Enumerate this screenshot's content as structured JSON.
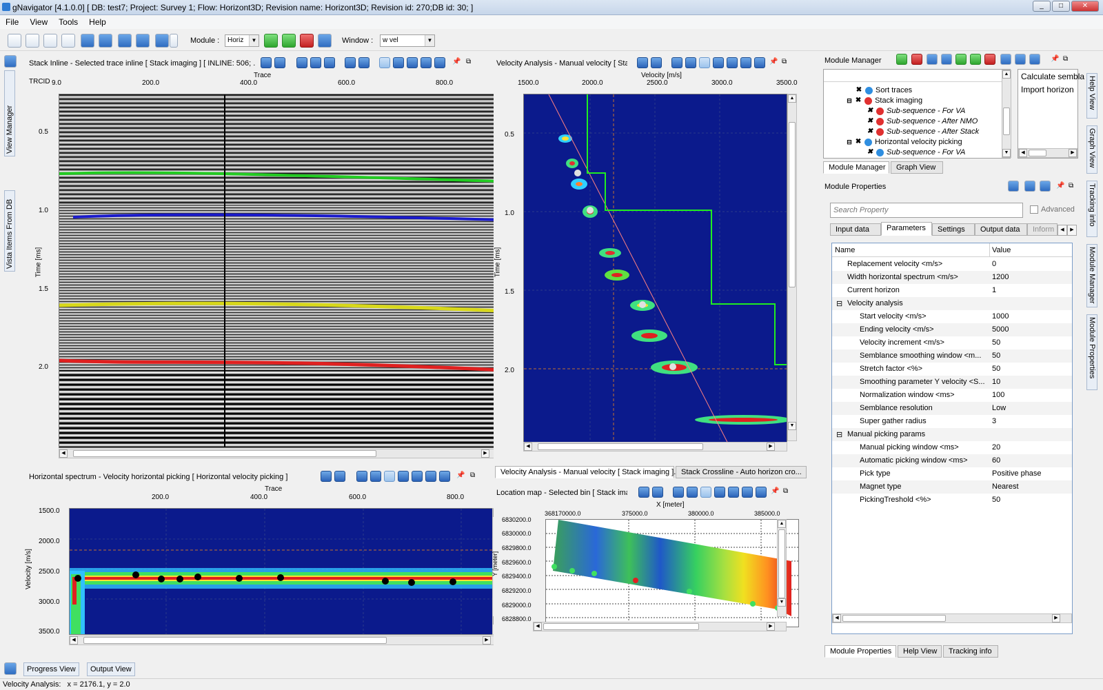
{
  "window": {
    "title": "gNavigator [4.1.0.0] [ DB: test7; Project: Survey 1; Flow: Horizont3D; Revision name: Horizont3D; Revision id: 270;DB id: 30; ]",
    "minimize": "_",
    "maximize": "□",
    "close": "✕"
  },
  "menu": {
    "file": "File",
    "view": "View",
    "tools": "Tools",
    "help": "Help"
  },
  "toolbar": {
    "module_label": "Module :",
    "module_value": "Horiz",
    "window_label": "Window :",
    "window_value": "w vel"
  },
  "left_sidebar": {
    "view_manager": "View Manager",
    "vista_items": "Vista Items From DB"
  },
  "right_sidebar": {
    "help_view": "Help View",
    "graph_view": "Graph View",
    "tracking_info": "Tracking info",
    "module_manager": "Module Manager",
    "module_properties": "Module Properties"
  },
  "stack_panel": {
    "title": "Stack Inline - Selected trace inline [ Stack imaging ] [ INLINE: 506; ...",
    "top_axis_label": "Trace",
    "corner_label": "TRCID",
    "x_ticks": [
      "9.0",
      "200.0",
      "400.0",
      "600.0",
      "800.0"
    ],
    "y_label": "Time [ms]",
    "y_ticks": [
      "0.5",
      "1.0",
      "1.5",
      "2.0"
    ]
  },
  "va_panel": {
    "title": "Velocity Analysis - Manual velocity [ Sta...",
    "top_axis_label": "Velocity [m/s]",
    "x_ticks": [
      "1500.0",
      "2000.0",
      "2500.0",
      "3000.0",
      "3500.0"
    ],
    "y_label": "Time [ms]",
    "y_ticks": [
      "0.5",
      "1.0",
      "1.5",
      "2.0"
    ],
    "tab1": "Velocity Analysis - Manual velocity [ Stack imaging ]...",
    "tab2": "Stack Crossline - Auto horizon cro..."
  },
  "hs_panel": {
    "title": "Horizontal spectrum - Velocity horizontal picking [ Horizontal velocity picking ]",
    "top_axis_label": "Trace",
    "x_ticks": [
      "200.0",
      "400.0",
      "600.0",
      "800.0"
    ],
    "y_label": "Velocity [m/s]",
    "y_ticks": [
      "1500.0",
      "2000.0",
      "2500.0",
      "3000.0",
      "3500.0"
    ]
  },
  "map_panel": {
    "title": "Location map - Selected bin [ Stack ima...",
    "top_axis_label": "X [meter]",
    "x_ticks": [
      "368170000.0",
      "375000.0",
      "380000.0",
      "385000.0"
    ],
    "y_label": "Y [meter]",
    "y_ticks": [
      "6830200.0",
      "6830000.0",
      "6829800.0",
      "6829600.0",
      "6829400.0",
      "6829200.0",
      "6829000.0",
      "6828800.0"
    ]
  },
  "module_manager": {
    "title": "Module Manager",
    "tree": [
      {
        "label": "Sort traces",
        "status": "ok",
        "italic": false,
        "level": 1
      },
      {
        "label": "Stack imaging",
        "status": "err",
        "italic": false,
        "level": 1
      },
      {
        "label": "Sub-sequence - For VA",
        "status": "err",
        "italic": true,
        "level": 2
      },
      {
        "label": "Sub-sequence - After NMO",
        "status": "err",
        "italic": true,
        "level": 2
      },
      {
        "label": "Sub-sequence - After Stack",
        "status": "err",
        "italic": true,
        "level": 2
      },
      {
        "label": "Horizontal velocity picking",
        "status": "ok",
        "italic": false,
        "level": 1
      },
      {
        "label": "Sub-sequence - For VA",
        "status": "ok",
        "italic": true,
        "level": 2
      }
    ],
    "side_items": [
      "Calculate sembla",
      "Import horizon"
    ],
    "tabs": [
      "Module Manager",
      "Graph View"
    ]
  },
  "module_properties": {
    "title": "Module Properties",
    "search_placeholder": "Search Property",
    "advanced_label": "Advanced",
    "tabs": [
      "Input data",
      "Parameters",
      "Settings",
      "Output data",
      "Inform"
    ],
    "col_name": "Name",
    "col_value": "Value",
    "rows": [
      {
        "name": "Replacement velocity <m/s>",
        "value": "0",
        "level": 1
      },
      {
        "name": "Width horizontal spectrum <m/s>",
        "value": "1200",
        "level": 1
      },
      {
        "name": "Current horizon",
        "value": "1",
        "level": 1
      },
      {
        "name": "Velocity analysis",
        "value": "",
        "level": 0
      },
      {
        "name": "Start velocity <m/s>",
        "value": "1000",
        "level": 2
      },
      {
        "name": "Ending velocity <m/s>",
        "value": "5000",
        "level": 2
      },
      {
        "name": "Velocity increment <m/s>",
        "value": "50",
        "level": 2
      },
      {
        "name": "Semblance smoothing window <m...",
        "value": "50",
        "level": 2
      },
      {
        "name": "Stretch factor <%>",
        "value": "50",
        "level": 2
      },
      {
        "name": "Smoothing parameter Y velocity <S...",
        "value": "10",
        "level": 2
      },
      {
        "name": "Normalization window <ms>",
        "value": "100",
        "level": 2
      },
      {
        "name": "Semblance resolution",
        "value": "Low",
        "level": 2
      },
      {
        "name": "Super gather radius",
        "value": "3",
        "level": 2
      },
      {
        "name": "Manual picking params",
        "value": "",
        "level": 0
      },
      {
        "name": "Manual picking window <ms>",
        "value": "20",
        "level": 2
      },
      {
        "name": "Automatic picking window <ms>",
        "value": "60",
        "level": 2
      },
      {
        "name": "Pick type",
        "value": "Positive phase",
        "level": 2
      },
      {
        "name": "Magnet type",
        "value": "Nearest",
        "level": 2
      },
      {
        "name": "PickingTreshold <%>",
        "value": "50",
        "level": 2
      }
    ],
    "bottom_tabs": [
      "Module Properties",
      "Help View",
      "Tracking info"
    ]
  },
  "bottom_bar": {
    "progress_view": "Progress View",
    "output_view": "Output View"
  },
  "status": {
    "text": "Velocity Analysis:   x = 2176.1, y = 2.0"
  },
  "colors": {
    "panel_bg": "#f0f0f0",
    "plot_blue": "#0b1a8c",
    "accent": "#2f6cc0"
  }
}
